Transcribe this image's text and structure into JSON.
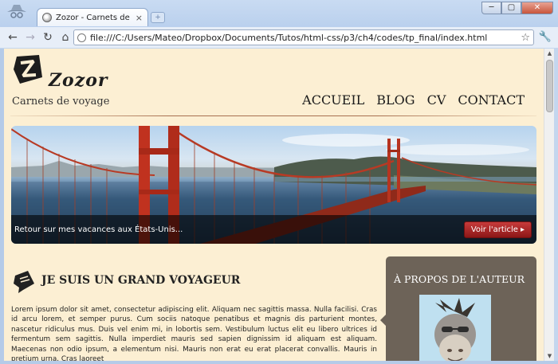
{
  "browser": {
    "tab_title": "Zozor - Carnets de voyage",
    "tab_close": "×",
    "new_tab": "+",
    "window_buttons": {
      "minimize": "─",
      "maximize": "▢",
      "close": "✕"
    },
    "nav": {
      "back": "←",
      "forward": "→",
      "reload": "↻",
      "home": "⌂"
    },
    "url": "file:///C:/Users/Mateo/Dropbox/Documents/Tutos/html-css/p3/ch4/codes/tp_final/index.html",
    "bookmark_star": "☆",
    "wrench": "🔧"
  },
  "site": {
    "brand": "Zozor",
    "tagline": "Carnets de voyage",
    "nav": [
      "ACCUEIL",
      "BLOG",
      "CV",
      "CONTACT"
    ]
  },
  "banner": {
    "caption": "Retour sur mes vacances aux États-Unis...",
    "button": "Voir l'article",
    "button_arrow": "▸"
  },
  "article": {
    "title": "JE SUIS UN GRAND VOYAGEUR",
    "body": "Lorem ipsum dolor sit amet, consectetur adipiscing elit. Aliquam nec sagittis massa. Nulla facilisi. Cras id arcu lorem, et semper purus. Cum sociis natoque penatibus et magnis dis parturient montes, nascetur ridiculus mus. Duis vel enim mi, in lobortis sem. Vestibulum luctus elit eu libero ultrices id fermentum sem sagittis. Nulla imperdiet mauris sed sapien dignissim id aliquam est aliquam. Maecenas non odio ipsum, a elementum nisi. Mauris non erat eu erat placerat convallis. Mauris in pretium urna. Cras laoreet"
  },
  "aside": {
    "title": "À PROPOS DE L'AUTEUR"
  },
  "colors": {
    "page_bg": "#fcefd3",
    "aside_bg": "#6d6358",
    "button_red": "#a82424"
  }
}
